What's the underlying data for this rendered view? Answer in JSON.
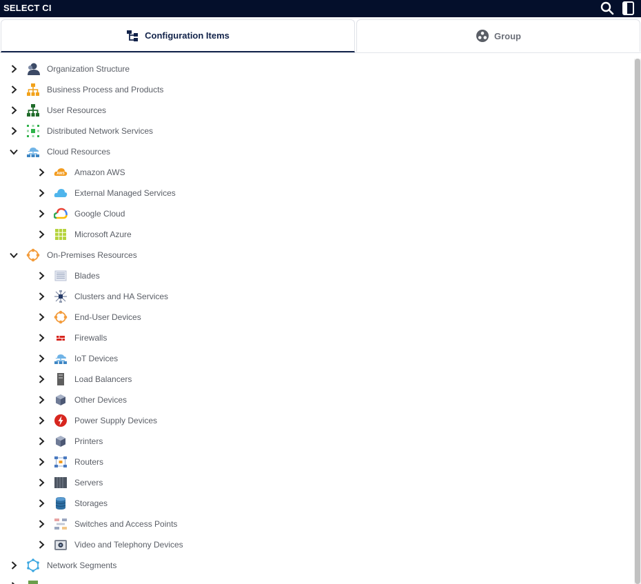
{
  "window": {
    "title": "SELECT CI"
  },
  "toolbar": {
    "search_icon": "search-icon",
    "panel_icon": "panel-toggle-icon"
  },
  "tabs": [
    {
      "label": "Configuration Items",
      "icon": "hierarchy-icon",
      "active": true
    },
    {
      "label": "Group",
      "icon": "group-icon",
      "active": false
    }
  ],
  "tree": {
    "items": [
      {
        "label": "Organization Structure",
        "level": 0,
        "expanded": false,
        "icon": "person-icon"
      },
      {
        "label": "Business Process and Products",
        "level": 0,
        "expanded": false,
        "icon": "org-chart-icon"
      },
      {
        "label": "User Resources",
        "level": 0,
        "expanded": false,
        "icon": "network-tree-icon"
      },
      {
        "label": "Distributed Network Services",
        "level": 0,
        "expanded": false,
        "icon": "distributed-nodes-icon"
      },
      {
        "label": "Cloud Resources",
        "level": 0,
        "expanded": true,
        "icon": "cloud-network-icon"
      },
      {
        "label": "Amazon AWS",
        "level": 1,
        "expanded": false,
        "icon": "aws-icon"
      },
      {
        "label": "External Managed Services",
        "level": 1,
        "expanded": false,
        "icon": "cloud-icon"
      },
      {
        "label": "Google Cloud",
        "level": 1,
        "expanded": false,
        "icon": "google-cloud-icon"
      },
      {
        "label": "Microsoft Azure",
        "level": 1,
        "expanded": false,
        "icon": "azure-grid-icon"
      },
      {
        "label": "On-Premises Resources",
        "level": 0,
        "expanded": true,
        "icon": "ring-nodes-icon"
      },
      {
        "label": "Blades",
        "level": 1,
        "expanded": false,
        "icon": "blade-icon"
      },
      {
        "label": "Clusters and HA Services",
        "level": 1,
        "expanded": false,
        "icon": "cluster-icon"
      },
      {
        "label": "End-User Devices",
        "level": 1,
        "expanded": false,
        "icon": "ring-nodes-icon"
      },
      {
        "label": "Firewalls",
        "level": 1,
        "expanded": false,
        "icon": "firewall-icon"
      },
      {
        "label": "IoT Devices",
        "level": 1,
        "expanded": false,
        "icon": "cloud-network-icon"
      },
      {
        "label": "Load Balancers",
        "level": 1,
        "expanded": false,
        "icon": "load-balancer-icon"
      },
      {
        "label": "Other Devices",
        "level": 1,
        "expanded": false,
        "icon": "cube-icon"
      },
      {
        "label": "Power Supply Devices",
        "level": 1,
        "expanded": false,
        "icon": "power-icon"
      },
      {
        "label": "Printers",
        "level": 1,
        "expanded": false,
        "icon": "cube-icon"
      },
      {
        "label": "Routers",
        "level": 1,
        "expanded": false,
        "icon": "router-icon"
      },
      {
        "label": "Servers",
        "level": 1,
        "expanded": false,
        "icon": "server-icon"
      },
      {
        "label": "Storages",
        "level": 1,
        "expanded": false,
        "icon": "storage-icon"
      },
      {
        "label": "Switches and Access Points",
        "level": 1,
        "expanded": false,
        "icon": "switch-icon"
      },
      {
        "label": "Video and Telephony Devices",
        "level": 1,
        "expanded": false,
        "icon": "camera-icon"
      },
      {
        "label": "Network Segments",
        "level": 0,
        "expanded": false,
        "icon": "network-segment-icon"
      },
      {
        "label": "",
        "level": 0,
        "expanded": false,
        "icon": "partial-icon"
      }
    ]
  },
  "colors": {
    "titlebar": "#040f2b",
    "tab_active_text": "#12234a",
    "label_text": "#5a5e66"
  }
}
